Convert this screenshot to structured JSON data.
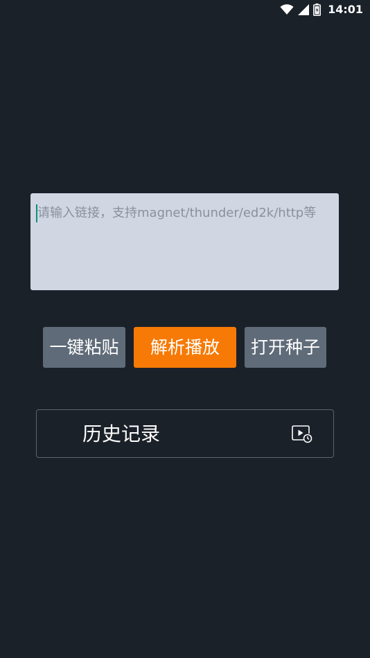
{
  "status_bar": {
    "time": "14:01",
    "icons": [
      "wifi-icon",
      "signal-icon",
      "battery-icon"
    ]
  },
  "link_input": {
    "value": "",
    "placeholder": "请输入链接，支持magnet/thunder/ed2k/http等"
  },
  "buttons": {
    "paste_label": "一键粘贴",
    "parse_label": "解析播放",
    "torrent_label": "打开种子"
  },
  "history": {
    "label": "历史记录",
    "icon": "video-history-icon"
  },
  "colors": {
    "background": "#1b2129",
    "input_bg": "#d0d6e2",
    "accent": "#f67a05",
    "secondary_button": "#5f6b78",
    "cursor": "#0f8f7a"
  }
}
